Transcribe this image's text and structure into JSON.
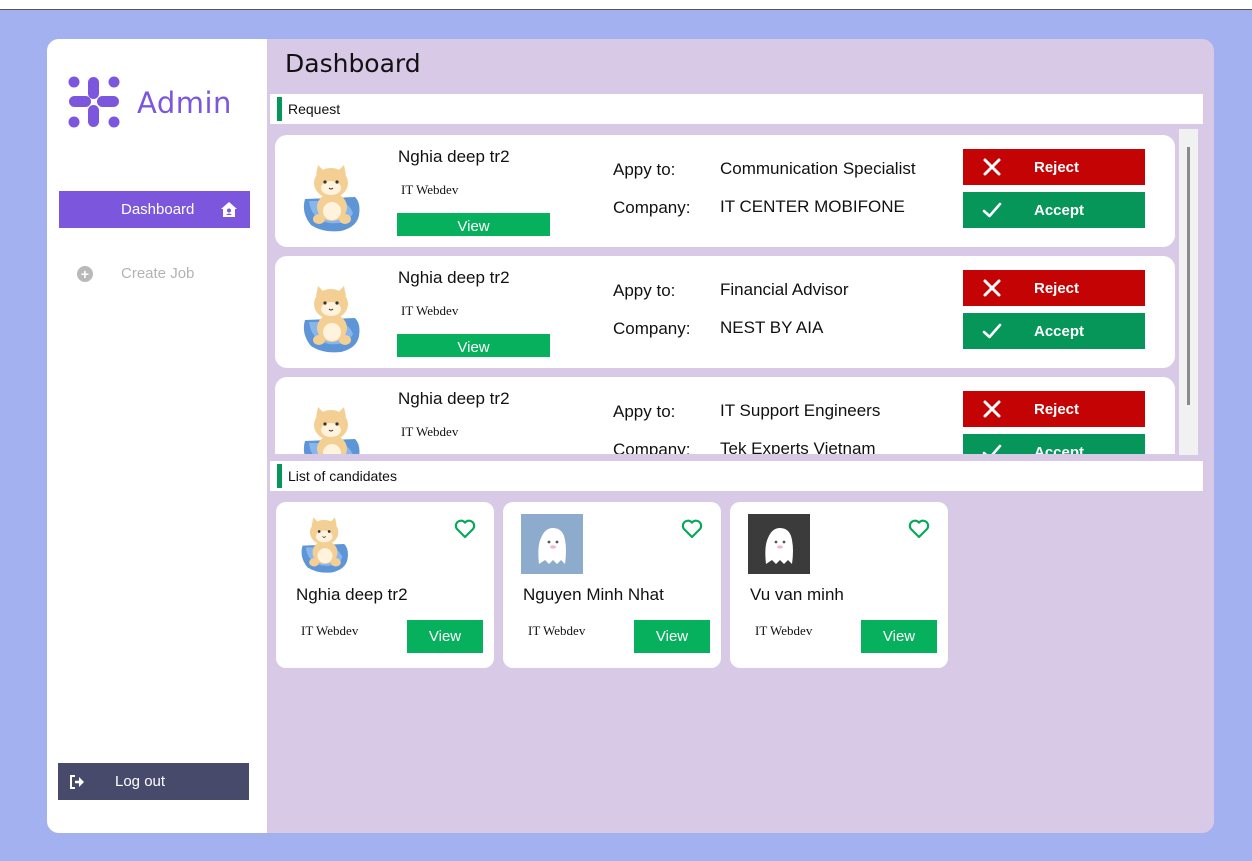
{
  "sidebar": {
    "logo_text": "Admin",
    "dashboard_label": "Dashboard",
    "create_job_label": "Create Job",
    "logout_label": "Log out"
  },
  "main": {
    "title": "Dashboard",
    "request_section_label": "Request",
    "candidates_section_label": "List of candidates",
    "apply_label": "Appy to:",
    "company_label": "Company:",
    "reject_label": "Reject",
    "accept_label": "Accept",
    "view_label": "View"
  },
  "requests": [
    {
      "name": "Nghia deep tr2",
      "role": "IT Webdev",
      "apply_to": "Communication Specialist",
      "company": "IT CENTER MOBIFONE"
    },
    {
      "name": "Nghia deep tr2",
      "role": "IT Webdev",
      "apply_to": "Financial Advisor",
      "company": "NEST BY AIA"
    },
    {
      "name": "Nghia deep tr2",
      "role": "IT Webdev",
      "apply_to": "IT Support Engineers",
      "company": "Tek Experts Vietnam"
    }
  ],
  "candidates": [
    {
      "name": "Nghia deep tr2",
      "role": "IT Webdev",
      "avatar": "shiba-chair"
    },
    {
      "name": "Nguyen Minh Nhat",
      "role": "IT Webdev",
      "avatar": "ghost-blue"
    },
    {
      "name": "Vu van minh",
      "role": "IT Webdev",
      "avatar": "ghost-dark"
    }
  ],
  "colors": {
    "accent": "#7c57dd",
    "reject": "#c40404",
    "accept": "#06965a",
    "view": "#07b05d",
    "backdrop": "#a3b1f0",
    "panel": "#d8cae6"
  }
}
